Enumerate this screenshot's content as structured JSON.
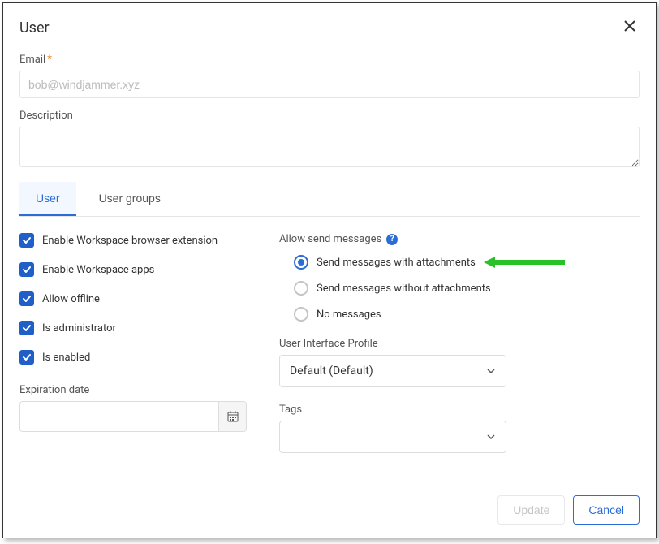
{
  "dialog": {
    "title": "User"
  },
  "form": {
    "email_label": "Email",
    "email_value": "bob@windjammer.xyz",
    "description_label": "Description",
    "description_value": ""
  },
  "tabs": {
    "user": "User",
    "user_groups": "User groups"
  },
  "checkboxes": {
    "browser_ext": "Enable Workspace browser extension",
    "apps": "Enable Workspace apps",
    "offline": "Allow offline",
    "admin": "Is administrator",
    "enabled": "Is enabled"
  },
  "expiration": {
    "label": "Expiration date",
    "value": ""
  },
  "send_messages": {
    "label": "Allow send messages",
    "opt_with": "Send messages with attachments",
    "opt_without": "Send messages without attachments",
    "opt_none": "No messages"
  },
  "ui_profile": {
    "label": "User Interface Profile",
    "value": "Default (Default)"
  },
  "tags": {
    "label": "Tags",
    "value": ""
  },
  "footer": {
    "update": "Update",
    "cancel": "Cancel"
  }
}
